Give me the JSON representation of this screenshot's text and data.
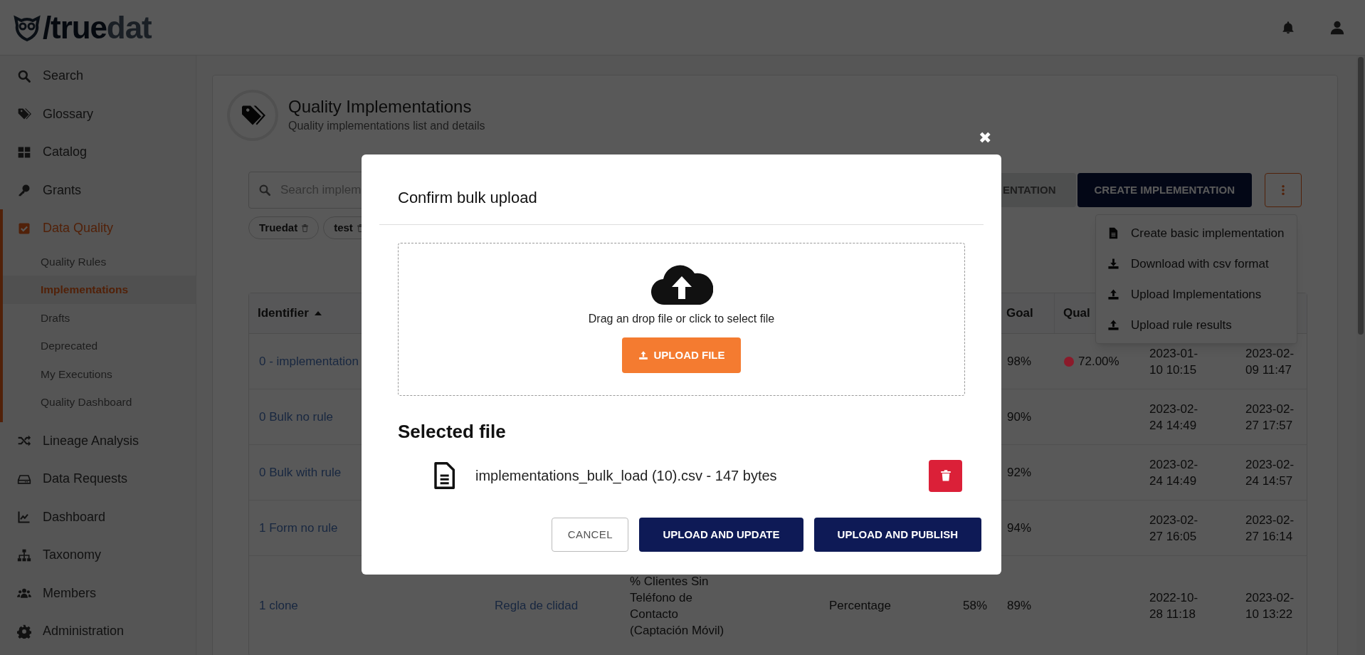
{
  "header": {
    "logo_parts": [
      "/true",
      "dat"
    ]
  },
  "sidebar": {
    "items": [
      {
        "label": "Search",
        "selected": false
      },
      {
        "label": "Glossary",
        "selected": false
      },
      {
        "label": "Catalog",
        "selected": false
      },
      {
        "label": "Grants",
        "selected": false
      },
      {
        "label": "Data Quality",
        "selected": true,
        "expanded": true,
        "children": [
          {
            "label": "Quality Rules",
            "selected": false
          },
          {
            "label": "Implementations",
            "selected": true
          },
          {
            "label": "Drafts",
            "selected": false
          },
          {
            "label": "Deprecated",
            "selected": false
          },
          {
            "label": "My Executions",
            "selected": false
          },
          {
            "label": "Quality Dashboard",
            "selected": false
          }
        ]
      },
      {
        "label": "Lineage Analysis",
        "selected": false
      },
      {
        "label": "Data Requests",
        "selected": false
      },
      {
        "label": "Dashboard",
        "selected": false
      },
      {
        "label": "Taxonomy",
        "selected": false
      },
      {
        "label": "Members",
        "selected": false
      },
      {
        "label": "Administration",
        "selected": false
      }
    ]
  },
  "page": {
    "title": "Quality Implementations",
    "subtitle": "Quality implementations list and details"
  },
  "toolbar": {
    "search": {
      "placeholder": "Search implem"
    },
    "buttons": [
      {
        "label": "ENTATION",
        "kind": "secondary"
      },
      {
        "label": "CREATE IMPLEMENTATION",
        "kind": "primary"
      }
    ]
  },
  "filters": [
    {
      "label": "Truedat"
    },
    {
      "label": "test"
    }
  ],
  "menu": {
    "items": [
      {
        "label": "Create basic implementation"
      },
      {
        "label": "Download with csv format"
      },
      {
        "label": "Upload Implementations"
      },
      {
        "label": "Upload rule results"
      }
    ]
  },
  "table": {
    "columns": {
      "identifier": {
        "label": "Identifier",
        "sorted": true
      },
      "goal": {
        "label": "Goal"
      },
      "quality": {
        "label": "Qual"
      }
    },
    "rows": [
      {
        "identifier": "0 - implementation",
        "goal": "98%",
        "quality": {
          "text": "72.00%",
          "color": "#8b1a2a"
        },
        "column_8": "2023-01-10 10:15",
        "column_9": "2023-02-09 11:47"
      },
      {
        "identifier": "0 Bulk no rule",
        "goal": "90%",
        "column_8": "2023-02-24 14:49",
        "column_9": "2023-02-27 17:57"
      },
      {
        "identifier": "0 Bulk with rule",
        "goal": "92%",
        "column_8": "2023-02-24 14:49",
        "column_9": "2023-02-24 14:57"
      },
      {
        "identifier": "1 Form no rule",
        "goal": "94%",
        "column_8": "2023-02-27 16:05",
        "column_9": "2023-02-27 16:14"
      },
      {
        "identifier": "1 clone",
        "column_2": "Regla de clidad",
        "column_3": "% Clientes Sin Teléfono de Contacto (Captación Móvil)",
        "column_4": "Percentage",
        "column_5": "58%",
        "goal": "89%",
        "column_8": "2022-10-28 11:18",
        "column_9": "2023-02-10 13:22"
      }
    ]
  },
  "modal": {
    "title": "Confirm bulk upload",
    "close": "✖",
    "dropzone_text": "Drag an drop file or click to select file",
    "upload_button": "UPLOAD FILE",
    "selected_heading": "Selected file",
    "file": "implementations_bulk_load (10).csv - 147 bytes",
    "buttons": [
      {
        "label": "CANCEL",
        "kind": "basic"
      },
      {
        "label": "UPLOAD AND UPDATE",
        "kind": "primary"
      },
      {
        "label": "UPLOAD AND PUBLISH",
        "kind": "primary"
      }
    ]
  }
}
